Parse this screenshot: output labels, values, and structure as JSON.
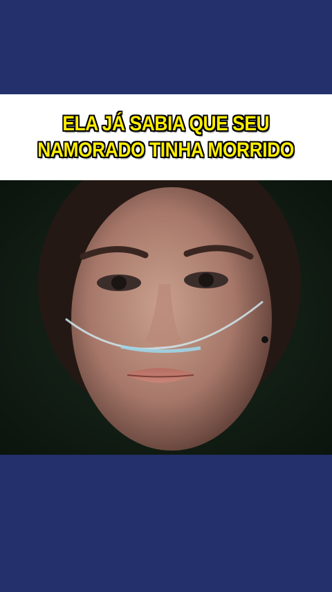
{
  "caption": {
    "line1": "ELA JÁ SABIA QUE SEU",
    "line2": "NAMORADO TINHA MORRIDO",
    "text_color": "#ffee00",
    "outline_color": "#000000"
  },
  "colors": {
    "background_band": "#24306b",
    "caption_box": "#ffffff"
  }
}
